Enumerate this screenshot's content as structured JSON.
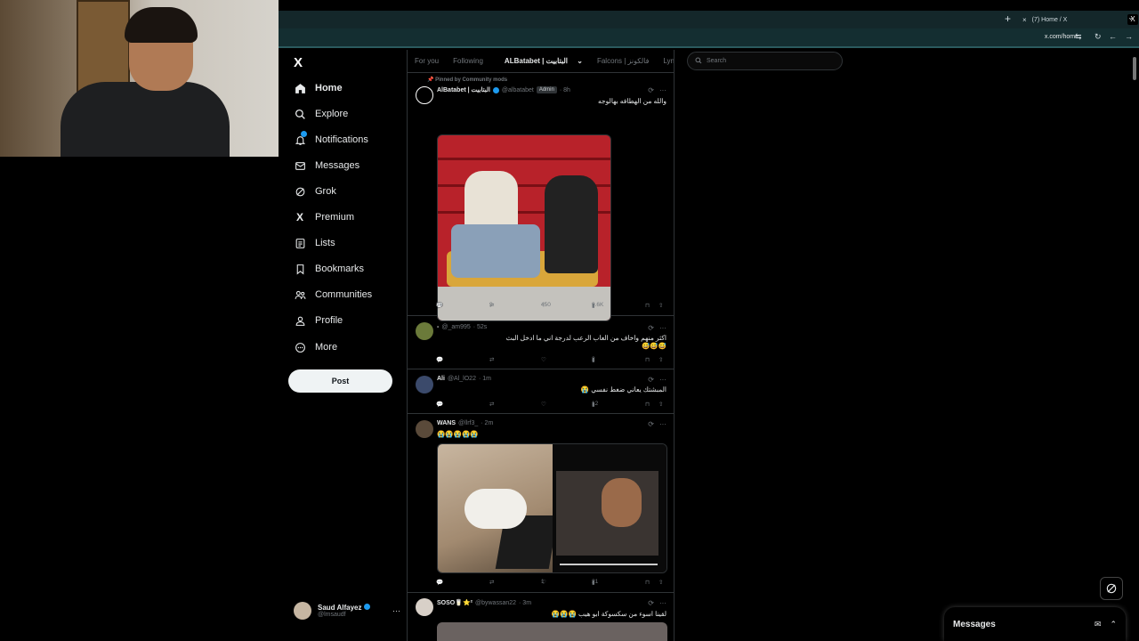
{
  "browser": {
    "tab_title": "(7) Home / X",
    "url": "x.com/home",
    "new_tab": "+",
    "tab_close": "×",
    "tab_favicon": "X",
    "tab_menu": "⌄"
  },
  "sidebar": {
    "logo": "X",
    "items": [
      {
        "label": "Home",
        "icon": "home-icon"
      },
      {
        "label": "Explore",
        "icon": "search-icon"
      },
      {
        "label": "Notifications",
        "icon": "bell-icon"
      },
      {
        "label": "Messages",
        "icon": "mail-icon"
      },
      {
        "label": "Grok",
        "icon": "grok-icon"
      },
      {
        "label": "Premium",
        "icon": "x-icon"
      },
      {
        "label": "Lists",
        "icon": "list-icon"
      },
      {
        "label": "Bookmarks",
        "icon": "bookmark-icon"
      },
      {
        "label": "Communities",
        "icon": "people-icon"
      },
      {
        "label": "Profile",
        "icon": "person-icon"
      },
      {
        "label": "More",
        "icon": "more-circle-icon"
      }
    ],
    "post_label": "Post",
    "account": {
      "name": "Saud Alfayez",
      "handle": "@lmsaudf",
      "more": "···"
    }
  },
  "feed": {
    "tabs": [
      "For you",
      "Following",
      "ALBatabet | البتابيت",
      "Falcons | فالكونز",
      "Lynx | لينكس"
    ],
    "selected_tab": 2,
    "tweets": [
      {
        "pinned_label": "Pinned by Community mods",
        "name": "AlBatabet | البتابيت",
        "handle": "@albatabet",
        "badge": "Admin",
        "time": "· 8h",
        "text": "والله من الهطافه بهالوجه",
        "stats": {
          "replies": "26",
          "reposts": "9",
          "likes": "450",
          "views": "9.6K"
        }
      },
      {
        "name": "-",
        "handle": "@_am995",
        "time": "· 52s",
        "text": "اكثر منهم واخاف من العاب الرعب لدرجة اني ما ادخل البث",
        "text2": "😅😅😅",
        "stats": {
          "replies": "",
          "reposts": "",
          "likes": "",
          "views": "2"
        }
      },
      {
        "name": "Ali",
        "handle": "@Al_lO22",
        "time": "· 1m",
        "text": "المبشتك يعاني ضغط نفسي 😭",
        "stats": {
          "replies": "",
          "reposts": "",
          "likes": "",
          "views": "12"
        }
      },
      {
        "name": "WANS",
        "handle": "@llrf3_",
        "time": "· 2m",
        "text": "😭😭😭😭😭",
        "stats": {
          "replies": "",
          "reposts": "",
          "likes": "1",
          "views": "21"
        }
      },
      {
        "name": "SOSO🥛⭐²",
        "handle": "@bywassan22",
        "time": "· 3m",
        "text": "لقينا اسوء من سكسوكة ابو هيب 😭😭😭"
      }
    ]
  },
  "search": {
    "placeholder": "Search"
  },
  "messages_drawer": {
    "title": "Messages"
  },
  "icons": {
    "reply": "reply-icon",
    "repost": "repost-icon",
    "like": "heart-icon",
    "views": "views-icon",
    "bookmark": "bookmark-icon",
    "share": "share-icon"
  },
  "colors": {
    "accent": "#1d9bf0",
    "background": "#000000",
    "border": "#2f3336",
    "muted": "#71767b"
  }
}
